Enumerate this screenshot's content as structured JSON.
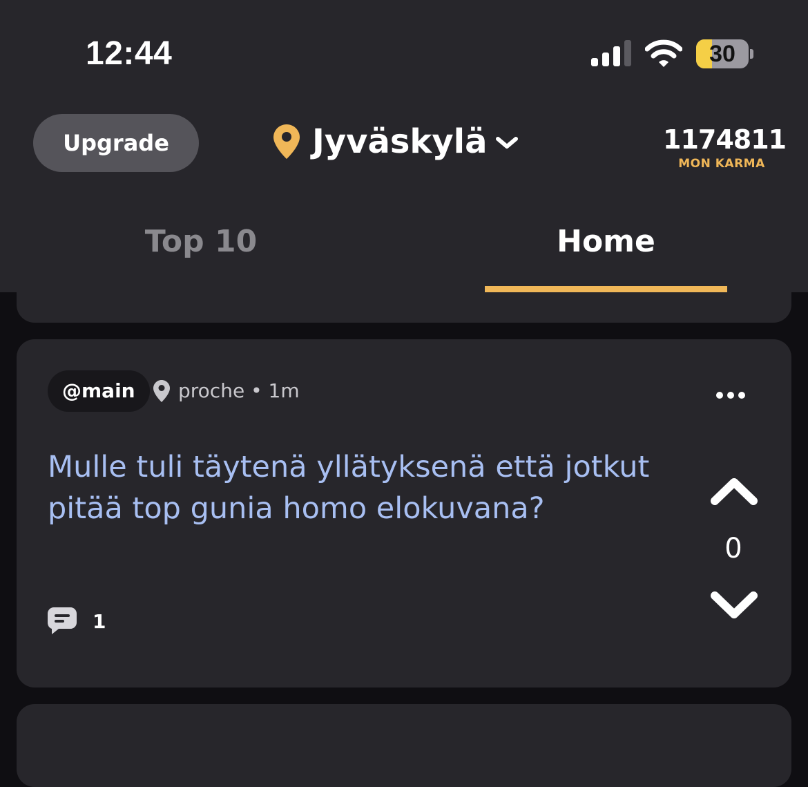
{
  "status_bar": {
    "time": "12:44",
    "signal_bars": 3,
    "signal_bars_total": 4,
    "battery_percent": 30,
    "battery_label": "30",
    "battery_color": "#f5cf46"
  },
  "header": {
    "upgrade_label": "Upgrade",
    "location": "Jyväskylä",
    "karma_value": "1174811",
    "karma_label": "MON KARMA",
    "accent_color": "#f0b758"
  },
  "tabs": [
    {
      "label": "Top 10",
      "active": false
    },
    {
      "label": "Home",
      "active": true
    }
  ],
  "post": {
    "channel": "@main",
    "distance": "proche",
    "age": "1m",
    "text": "Mulle tuli täytenä yllätyksenä että jotkut pitää top gunia homo elokuvana?",
    "votes": "0",
    "comments": "1",
    "text_color": "#a8bff2"
  },
  "icons": {
    "location": "map-pin-icon",
    "dropdown": "chevron-down-icon",
    "more": "more-horizontal-icon",
    "upvote": "chevron-up-icon",
    "downvote": "chevron-down-icon",
    "comments": "chat-bubble-icon"
  }
}
